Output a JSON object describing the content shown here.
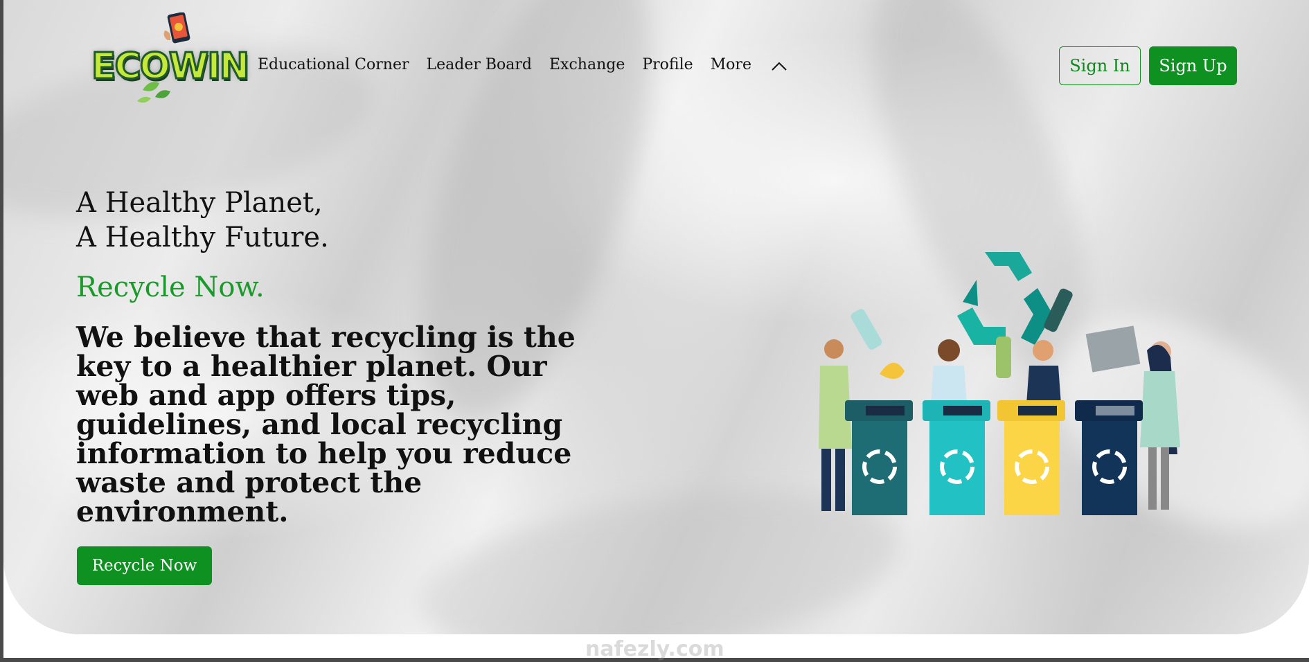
{
  "brand": {
    "logo_text": "ECOWIN",
    "accent": "#0f9122"
  },
  "nav": {
    "items": [
      {
        "label": "Educational Corner"
      },
      {
        "label": "Leader Board"
      },
      {
        "label": "Exchange"
      },
      {
        "label": "Profile"
      },
      {
        "label": "More"
      }
    ],
    "more_icon": "chevron-up-icon"
  },
  "auth": {
    "sign_in": "Sign In",
    "sign_up": "Sign Up"
  },
  "hero": {
    "headline_line1": "A Healthy Planet,",
    "headline_line2": "A Healthy Future.",
    "tagline": "Recycle Now.",
    "description": "We believe that recycling is the key to a healthier planet. Our web and app offers tips, guidelines, and local recycling information to help you reduce waste and protect the environment.",
    "cta": "Recycle Now",
    "illustration_icon": "people-recycling-bins-illustration"
  },
  "watermark": "nafezly.com"
}
